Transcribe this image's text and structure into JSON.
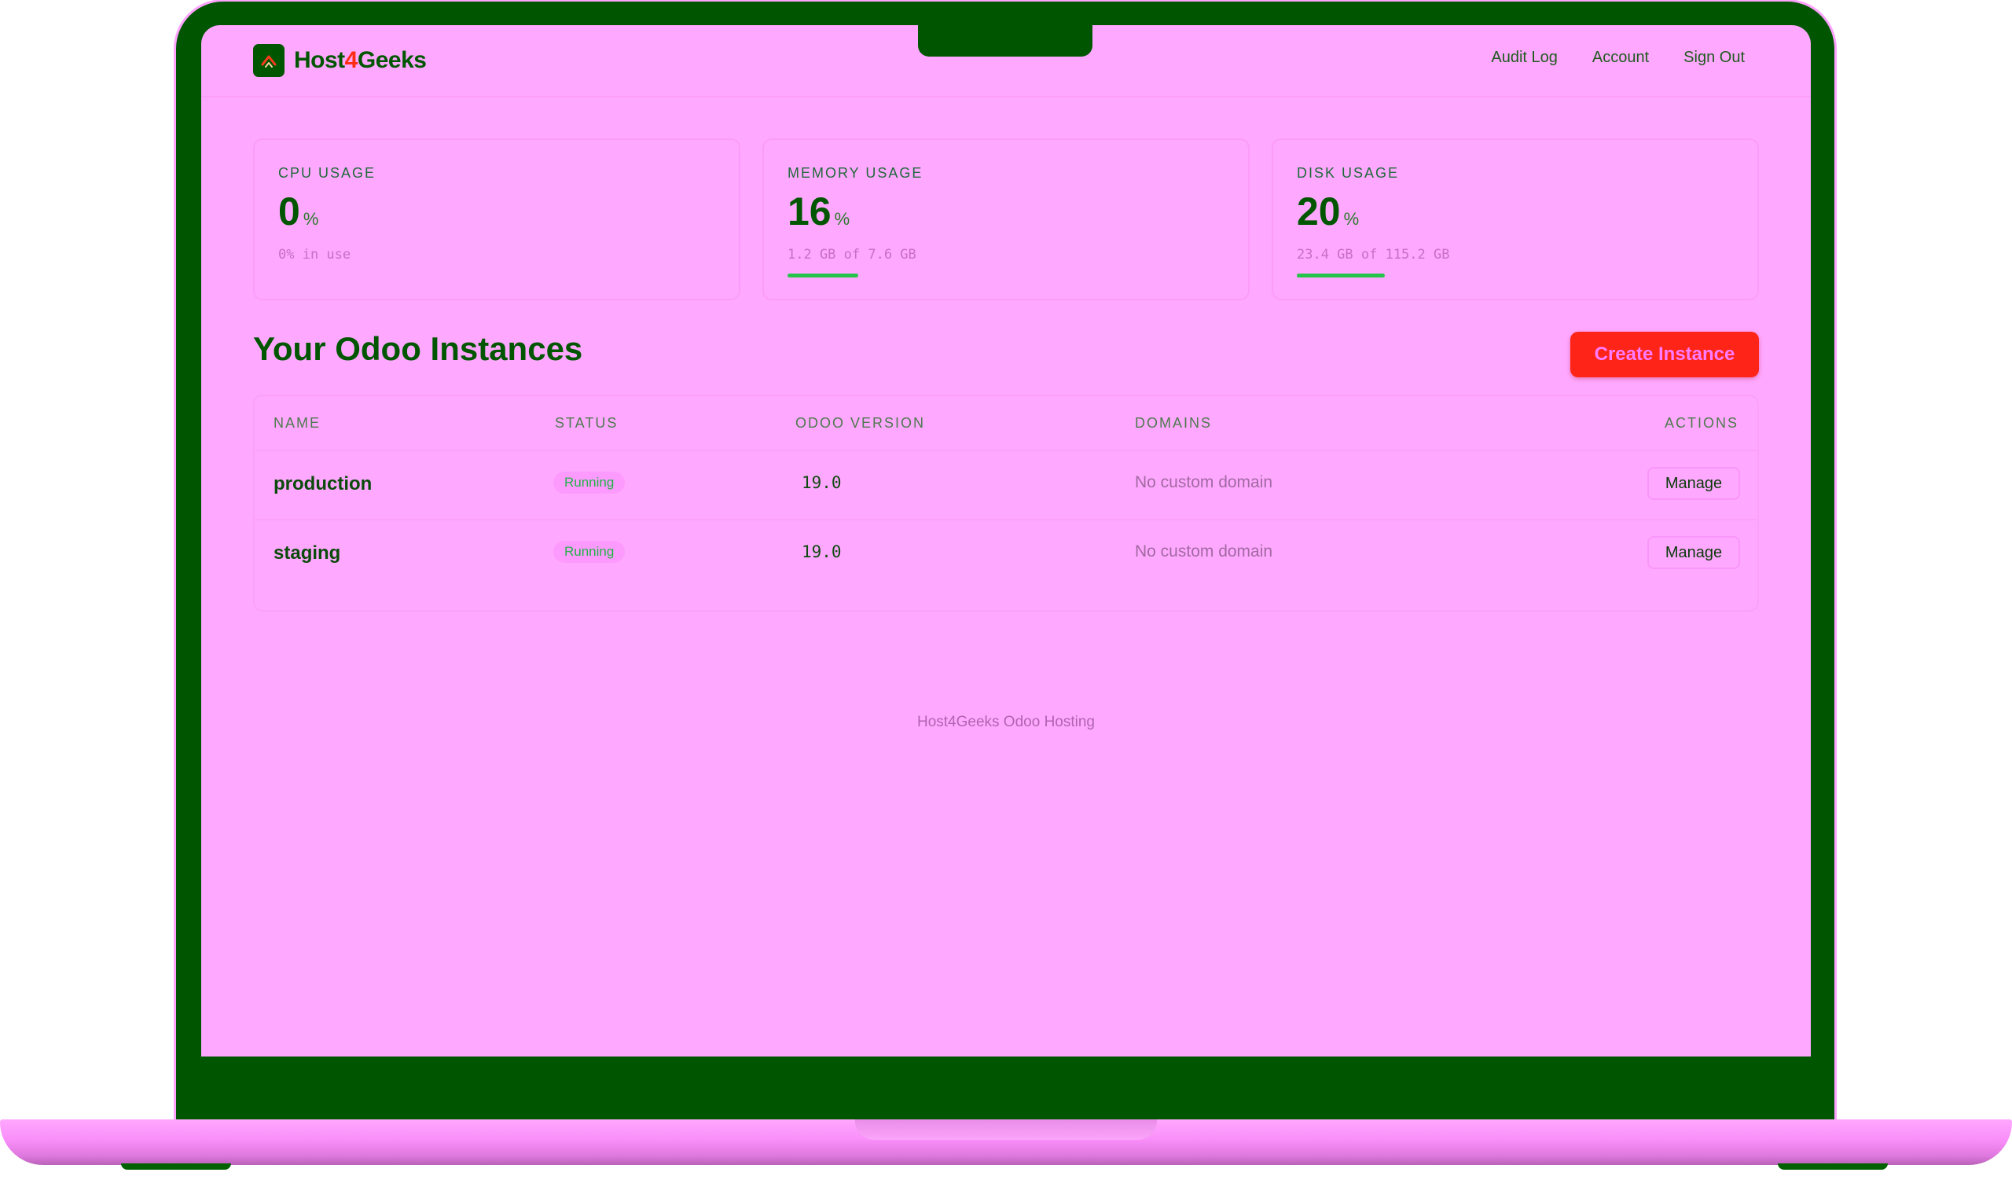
{
  "brand": {
    "name_prefix": "Host",
    "name_digit": "4",
    "name_suffix": "Geeks"
  },
  "nav": {
    "links": [
      "Audit Log",
      "Account",
      "Sign Out"
    ]
  },
  "stats": [
    {
      "label": "CPU USAGE",
      "value": "0",
      "unit": "%",
      "detail": "0% in use",
      "fraction": 0.0
    },
    {
      "label": "MEMORY USAGE",
      "value": "16",
      "unit": "%",
      "detail": "1.2 GB of 7.6 GB",
      "fraction": 0.16
    },
    {
      "label": "DISK USAGE",
      "value": "20",
      "unit": "%",
      "detail": "23.4 GB of 115.2 GB",
      "fraction": 0.2
    }
  ],
  "instances": {
    "title": "Your Odoo Instances",
    "create_label": "Create Instance",
    "columns": [
      "NAME",
      "STATUS",
      "ODOO VERSION",
      "DOMAINS",
      "ACTIONS"
    ],
    "rows": [
      {
        "name": "production",
        "status": "Running",
        "version": "19.0",
        "domains": "No custom domain",
        "action": "Manage"
      },
      {
        "name": "staging",
        "status": "Running",
        "version": "19.0",
        "domains": "No custom domain",
        "action": "Manage"
      }
    ]
  },
  "footer": "Host4Geeks Odoo Hosting",
  "colors": {
    "accent": "#005600",
    "danger": "#ff2418",
    "success": "#24c44a"
  }
}
